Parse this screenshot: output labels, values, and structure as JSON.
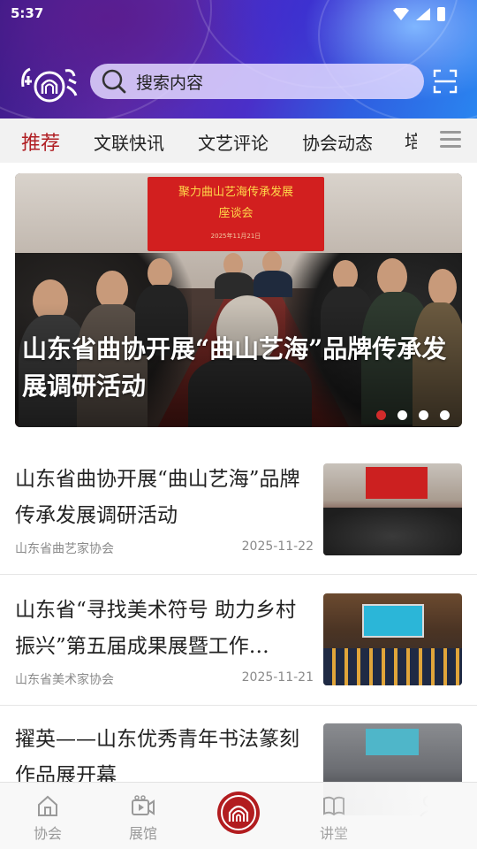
{
  "status_bar": {
    "time": "5:37"
  },
  "header": {
    "logo_alt": "app-logo",
    "search": {
      "placeholder": "搜索内容"
    }
  },
  "tabs": [
    {
      "label": "推荐",
      "active": true
    },
    {
      "label": "文联快讯",
      "active": false
    },
    {
      "label": "文艺评论",
      "active": false
    },
    {
      "label": "协会动态",
      "active": false
    },
    {
      "label": "培",
      "active": false
    }
  ],
  "carousel": {
    "caption": "山东省曲协开展“曲山艺海”品牌传承发展调研活动",
    "banner_title": "聚力曲山艺海传承发展",
    "banner_subtitle": "座谈会",
    "banner_date": "2025年11月21日",
    "slide_count": 4,
    "active_index": 0
  },
  "articles": [
    {
      "title": "山东省曲协开展“曲山艺海”品牌传承发展调研活动",
      "source": "山东省曲艺家协会",
      "date": "2025-11-22"
    },
    {
      "title": "山东省“寻找美术符号 助力乡村振兴”第五届成果展暨工作…",
      "source": "山东省美术家协会",
      "date": "2025-11-21"
    },
    {
      "title": "擢英——山东优秀青年书法篆刻作品展开幕",
      "source": "",
      "date": ""
    }
  ],
  "bottom_nav": [
    {
      "label": "协会",
      "icon": "home-icon"
    },
    {
      "label": "展馆",
      "icon": "video-icon"
    },
    {
      "label": "",
      "icon": "logo-center-icon"
    },
    {
      "label": "讲堂",
      "icon": "book-icon"
    },
    {
      "label": "",
      "icon": "profile-icon"
    }
  ],
  "colors": {
    "accent_red": "#b01e23",
    "header_purple": "#4a2fc9",
    "tab_bg": "#f2f2f2"
  }
}
